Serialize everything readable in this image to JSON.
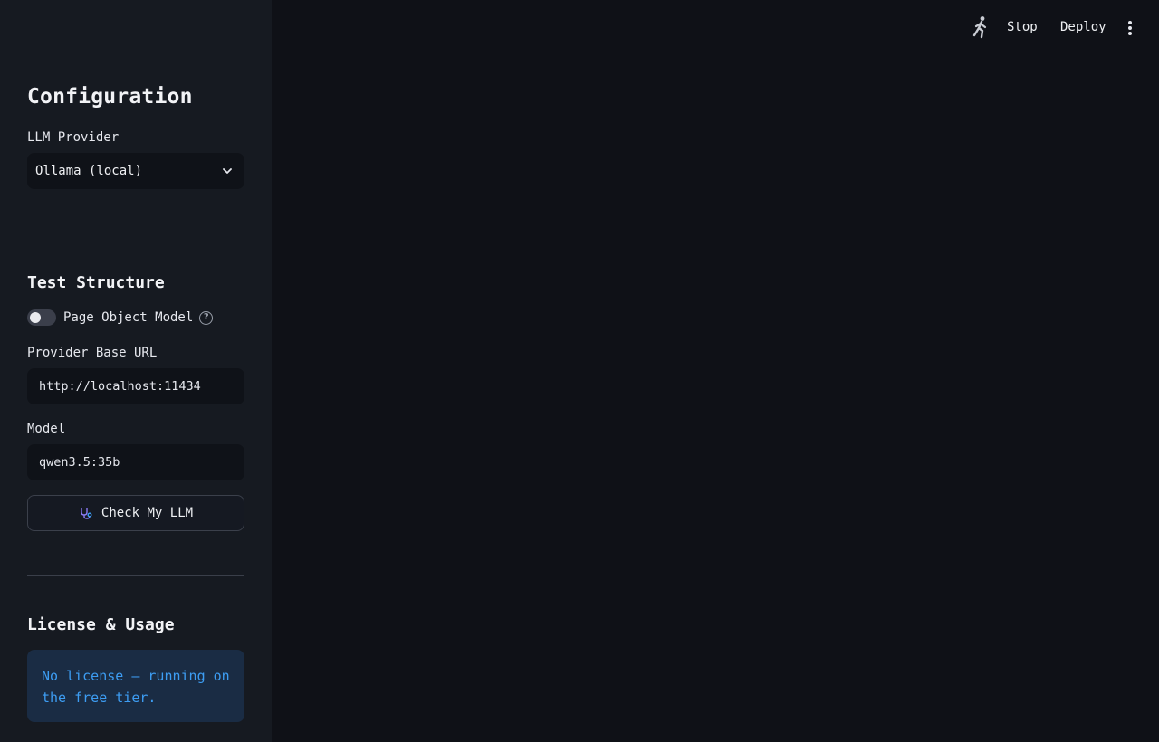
{
  "sidebar": {
    "heading": "Configuration",
    "provider": {
      "label": "LLM Provider",
      "selected": "Ollama (local)"
    },
    "test_structure": {
      "heading": "Test Structure",
      "pom_toggle_label": "Page Object Model",
      "pom_toggle_on": false
    },
    "base_url": {
      "label": "Provider Base URL",
      "value": "http://localhost:11434"
    },
    "model": {
      "label": "Model",
      "value": "qwen3.5:35b"
    },
    "check_button_label": "Check My LLM",
    "license": {
      "heading": "License & Usage",
      "message": "No license — running on the free tier."
    }
  },
  "header": {
    "stop_label": "Stop",
    "deploy_label": "Deploy"
  },
  "icons": {
    "running": "running-man-icon",
    "chevron": "chevron-down-icon",
    "help": "help-circle-icon",
    "stethoscope": "stethoscope-icon",
    "menu": "more-vertical-icon"
  },
  "colors": {
    "background": "#0f1117",
    "sidebar": "#161a21",
    "info_bg": "#1a2c44",
    "info_text": "#3d9df3"
  }
}
